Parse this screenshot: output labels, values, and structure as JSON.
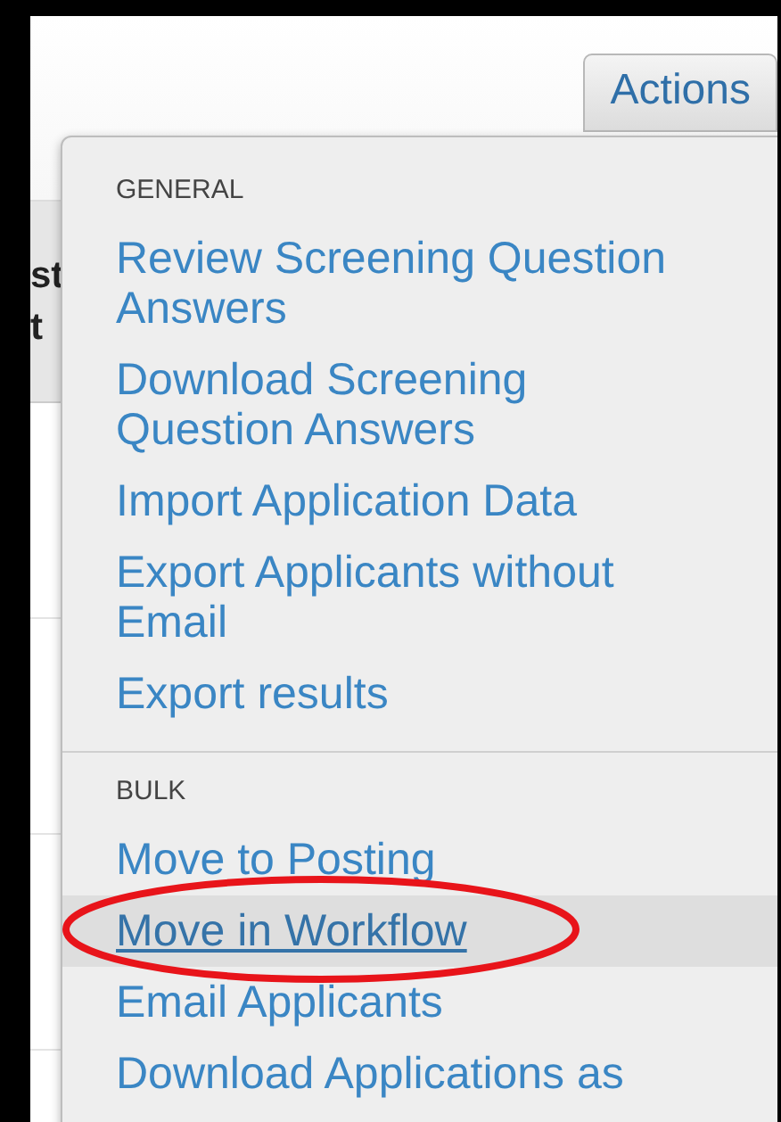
{
  "actions_button": {
    "label": "Actions"
  },
  "background_header": [
    "st",
    "t"
  ],
  "menu": {
    "sections": [
      {
        "heading": "GENERAL",
        "items": [
          {
            "label": "Review Screening Question Answers",
            "selected": false,
            "circled": false
          },
          {
            "label": "Download Screening Question Answers",
            "selected": false,
            "circled": false
          },
          {
            "label": "Import Application Data",
            "selected": false,
            "circled": false
          },
          {
            "label": "Export Applicants without Email",
            "selected": false,
            "circled": false
          },
          {
            "label": "Export results",
            "selected": false,
            "circled": false
          }
        ]
      },
      {
        "heading": "BULK",
        "items": [
          {
            "label": "Move to Posting",
            "selected": false,
            "circled": false
          },
          {
            "label": "Move in Workflow",
            "selected": true,
            "circled": true
          },
          {
            "label": "Email Applicants",
            "selected": false,
            "circled": false
          },
          {
            "label": "Download Applications as",
            "selected": false,
            "circled": false
          }
        ]
      }
    ]
  }
}
